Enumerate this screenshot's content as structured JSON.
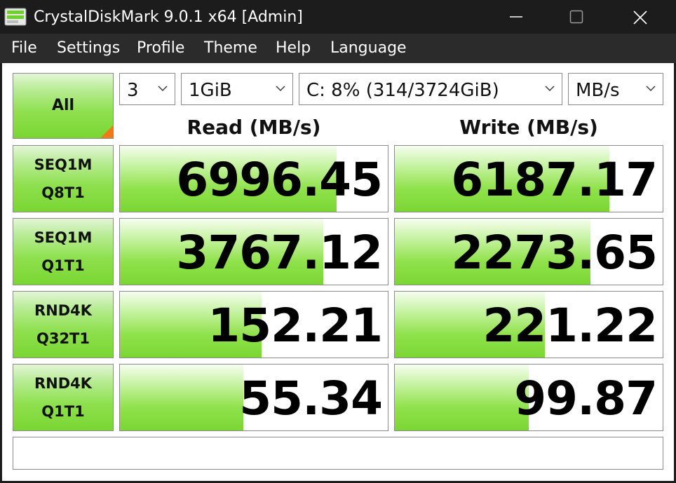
{
  "window": {
    "title": "CrystalDiskMark 9.0.1 x64 [Admin]",
    "icons": [
      "app-icon",
      "minimize-icon",
      "maximize-icon",
      "close-icon"
    ]
  },
  "menu": {
    "items": [
      "File",
      "Settings",
      "Profile",
      "Theme",
      "Help",
      "Language"
    ]
  },
  "controls": {
    "all_label": "All",
    "count": "3",
    "size": "1GiB",
    "drive": "C: 8% (314/3724GiB)",
    "unit": "MB/s"
  },
  "headers": {
    "read": "Read (MB/s)",
    "write": "Write (MB/s)"
  },
  "tests": [
    {
      "line1": "SEQ1M",
      "line2": "Q8T1",
      "read": "6996.45",
      "write": "6187.17",
      "read_fill": 0.81,
      "write_fill": 0.8
    },
    {
      "line1": "SEQ1M",
      "line2": "Q1T1",
      "read": "3767.12",
      "write": "2273.65",
      "read_fill": 0.76,
      "write_fill": 0.73
    },
    {
      "line1": "RND4K",
      "line2": "Q32T1",
      "read": "152.21",
      "write": "221.22",
      "read_fill": 0.53,
      "write_fill": 0.56
    },
    {
      "line1": "RND4K",
      "line2": "Q1T1",
      "read": "55.34",
      "write": "99.87",
      "read_fill": 0.46,
      "write_fill": 0.5
    }
  ],
  "comment": "",
  "colors": {
    "titlebar_bg": "#1c1c1c",
    "menubar_bg": "#2b2b2b",
    "bar_green": "#7ad632",
    "corner_orange": "#f07a1a"
  }
}
